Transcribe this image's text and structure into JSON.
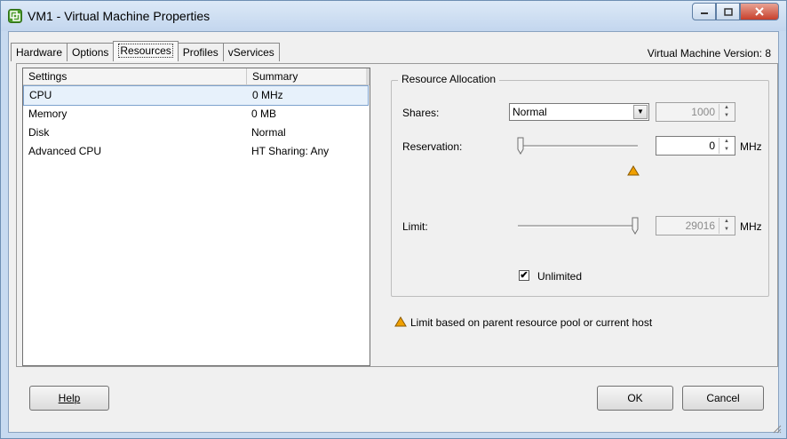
{
  "window": {
    "title": "VM1 - Virtual Machine Properties",
    "app_icon": "vsphere-vm-icon"
  },
  "tabs": [
    {
      "label": "Hardware",
      "active": false
    },
    {
      "label": "Options",
      "active": false
    },
    {
      "label": "Resources",
      "active": true
    },
    {
      "label": "Profiles",
      "active": false
    },
    {
      "label": "vServices",
      "active": false
    }
  ],
  "vm_version": "Virtual Machine Version: 8",
  "list": {
    "headers": [
      "Settings",
      "Summary"
    ],
    "rows": [
      {
        "setting": "CPU",
        "summary": "0 MHz",
        "selected": true
      },
      {
        "setting": "Memory",
        "summary": "0 MB",
        "selected": false
      },
      {
        "setting": "Disk",
        "summary": "Normal",
        "selected": false
      },
      {
        "setting": "Advanced CPU",
        "summary": "HT Sharing: Any",
        "selected": false
      }
    ]
  },
  "resource": {
    "group_title": "Resource Allocation",
    "shares_label": "Shares:",
    "shares_value": "Normal",
    "shares_number": "1000",
    "reservation_label": "Reservation:",
    "reservation_value": "0",
    "reservation_unit": "MHz",
    "reservation_slider_fraction": 0,
    "limit_label": "Limit:",
    "limit_value": "29016",
    "limit_unit": "MHz",
    "limit_slider_fraction": 1,
    "unlimited_label": "Unlimited",
    "unlimited_checked": true,
    "warning_color": "#f0a000"
  },
  "footnote": "Limit based on parent resource pool or current host",
  "buttons": {
    "help": "Help",
    "ok": "OK",
    "cancel": "Cancel"
  }
}
